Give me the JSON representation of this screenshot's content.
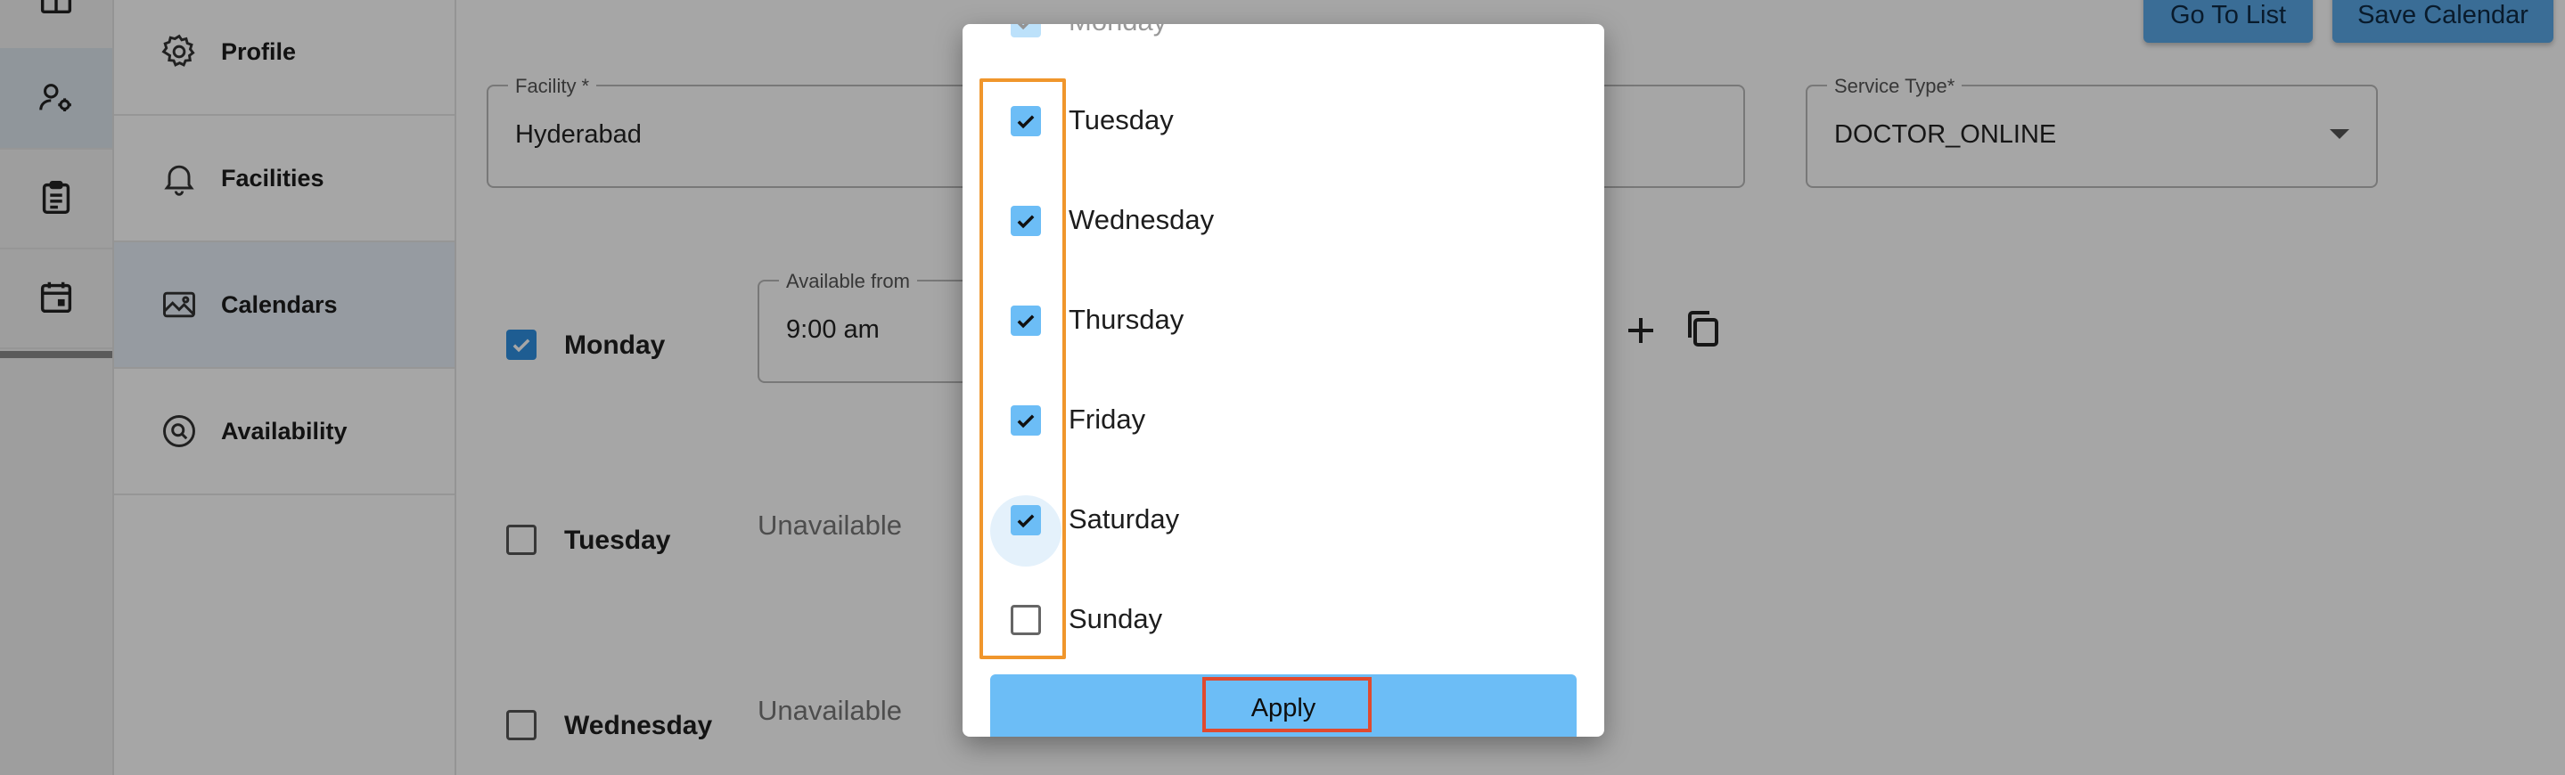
{
  "nav": {
    "items": [
      {
        "label": "Profile",
        "icon": "gear-icon"
      },
      {
        "label": "Facilities",
        "icon": "bell-icon"
      },
      {
        "label": "Calendars",
        "icon": "image-icon"
      },
      {
        "label": "Availability",
        "icon": "search-circle-icon"
      }
    ]
  },
  "toolbar": {
    "go_to_list": "Go To List",
    "save_calendar": "Save Calendar"
  },
  "form": {
    "facility_label": "Facility *",
    "facility_value": "Hyderabad",
    "service_type_label": "Service Type*",
    "service_type_value": "DOCTOR_ONLINE",
    "available_from_label": "Available from",
    "available_from_value": "9:00 am"
  },
  "schedule": {
    "days": [
      {
        "label": "Monday",
        "checked": true
      },
      {
        "label": "Tuesday",
        "checked": false,
        "status": "Unavailable"
      },
      {
        "label": "Wednesday",
        "checked": false,
        "status": "Unavailable"
      }
    ]
  },
  "dialog": {
    "options": [
      {
        "label": "Monday",
        "checked": true
      },
      {
        "label": "Tuesday",
        "checked": true
      },
      {
        "label": "Wednesday",
        "checked": true
      },
      {
        "label": "Thursday",
        "checked": true
      },
      {
        "label": "Friday",
        "checked": true
      },
      {
        "label": "Saturday",
        "checked": true
      },
      {
        "label": "Sunday",
        "checked": false
      }
    ],
    "apply_label": "Apply"
  },
  "colors": {
    "accent": "#6cbdf6",
    "highlight_orange": "#f0962c",
    "highlight_red": "#e04a2f"
  }
}
